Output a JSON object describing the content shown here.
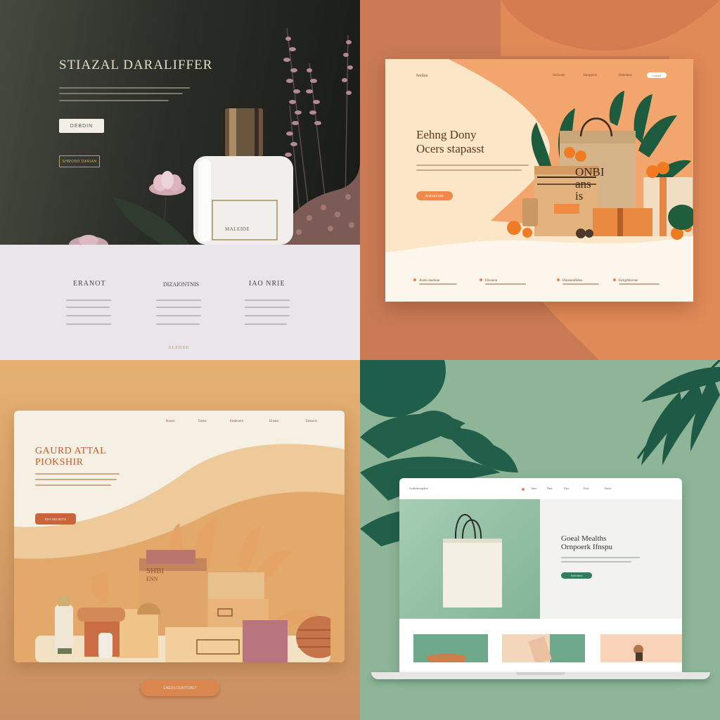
{
  "q1": {
    "title": "STIAZAL DARALIFFER",
    "button_label": "DEBDIN",
    "outline_button_label": "SHMONO DARIAN",
    "label_card": "MALEIDE",
    "columns": [
      {
        "heading": "ERANOT"
      },
      {
        "heading": "DIZAIONTNIS"
      },
      {
        "heading": "IAO NRIE"
      }
    ],
    "footer_link": "ELEDDE"
  },
  "q2": {
    "logo": "Iveliza",
    "nav": [
      "Indiwate",
      "Intoppoiy",
      "Ettielanis"
    ],
    "nav_button": "Lidopit",
    "headline": [
      "Eehng Dony",
      "Ocers stapasst"
    ],
    "cta_label": "Endvaut tdot",
    "bag_text": [
      "ONBI",
      "ans",
      "is"
    ],
    "features": [
      {
        "title": "Aveto dueliom"
      },
      {
        "title": "Divenon"
      },
      {
        "title": "Dieannidlidos"
      },
      {
        "title": "Entigrbinvine"
      }
    ]
  },
  "q3": {
    "nav": [
      "Rnoes",
      "Entne",
      "Endeuotn",
      "Einans",
      "Entiacis"
    ],
    "headline": [
      "GAURD ATTAL",
      "PIOKSHIR"
    ],
    "cta_label": "EIHI DEOIDTS",
    "box_text": [
      "SHBI",
      "ENN"
    ],
    "bottom_button": "ENEDS DENITDRET"
  },
  "q4": {
    "brand": "Grabsdensrpdeet",
    "nav": [
      "Inns",
      "Dnis",
      "Eino",
      "Eiris",
      "Entris"
    ],
    "headline": [
      "Goeal Mealths",
      "Ornpoerk Ifnspu"
    ],
    "cta_label": "Endi adow"
  }
}
